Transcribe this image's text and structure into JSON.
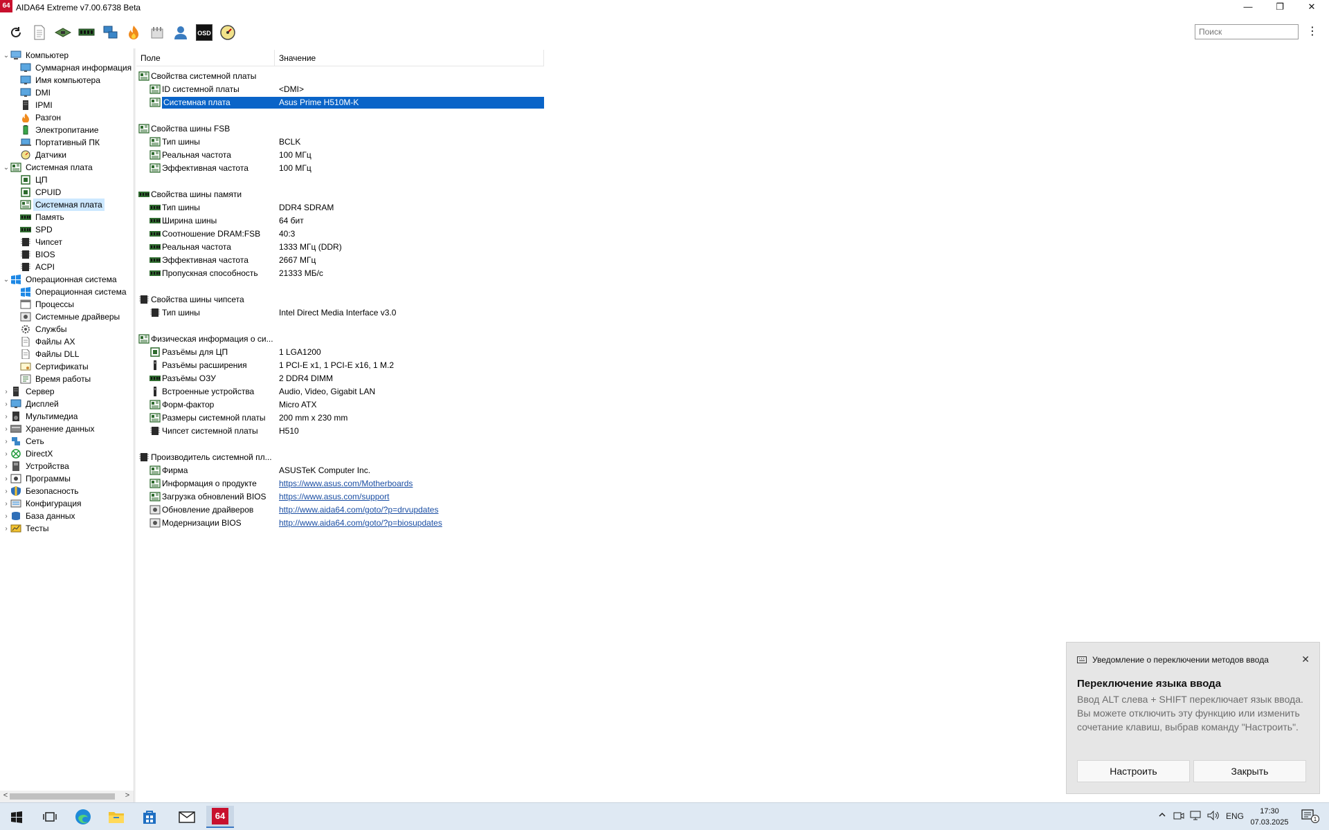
{
  "window": {
    "app_icon_text": "64",
    "title": "AIDA64 Extreme v7.00.6738 Beta",
    "controls": {
      "minimize": "—",
      "maximize": "❐",
      "close": "✕"
    }
  },
  "toolbar": {
    "icons": [
      "refresh-icon",
      "report-icon",
      "motherboard-icon",
      "memory-icon",
      "network-icon",
      "flame-icon",
      "tools-icon",
      "user-icon",
      "osd-icon",
      "gauge-icon"
    ],
    "osd_label": "OSD",
    "search_placeholder": "Поиск",
    "menu_glyph": "⋮"
  },
  "tree": {
    "nodes": [
      {
        "label": "Компьютер",
        "level": 0,
        "expanded": true,
        "icon": "computer-icon"
      },
      {
        "label": "Суммарная информация",
        "level": 1,
        "icon": "monitor-icon"
      },
      {
        "label": "Имя компьютера",
        "level": 1,
        "icon": "monitor-icon"
      },
      {
        "label": "DMI",
        "level": 1,
        "icon": "monitor-icon"
      },
      {
        "label": "IPMI",
        "level": 1,
        "icon": "server-icon"
      },
      {
        "label": "Разгон",
        "level": 1,
        "icon": "flame-icon"
      },
      {
        "label": "Электропитание",
        "level": 1,
        "icon": "battery-icon"
      },
      {
        "label": "Портативный ПК",
        "level": 1,
        "icon": "laptop-icon"
      },
      {
        "label": "Датчики",
        "level": 1,
        "icon": "gauge-icon"
      },
      {
        "label": "Системная плата",
        "level": 0,
        "expanded": true,
        "icon": "motherboard-icon"
      },
      {
        "label": "ЦП",
        "level": 1,
        "icon": "cpu-icon"
      },
      {
        "label": "CPUID",
        "level": 1,
        "icon": "cpu-icon"
      },
      {
        "label": "Системная плата",
        "level": 1,
        "icon": "motherboard-icon",
        "selected": true
      },
      {
        "label": "Память",
        "level": 1,
        "icon": "memory-icon"
      },
      {
        "label": "SPD",
        "level": 1,
        "icon": "memory-icon"
      },
      {
        "label": "Чипсет",
        "level": 1,
        "icon": "chip-icon"
      },
      {
        "label": "BIOS",
        "level": 1,
        "icon": "chip-icon"
      },
      {
        "label": "ACPI",
        "level": 1,
        "icon": "chip-icon"
      },
      {
        "label": "Операционная система",
        "level": 0,
        "expanded": true,
        "icon": "windows-icon"
      },
      {
        "label": "Операционная система",
        "level": 1,
        "icon": "windows-icon"
      },
      {
        "label": "Процессы",
        "level": 1,
        "icon": "window-icon"
      },
      {
        "label": "Системные драйверы",
        "level": 1,
        "icon": "driver-icon"
      },
      {
        "label": "Службы",
        "level": 1,
        "icon": "gear-icon"
      },
      {
        "label": "Файлы AX",
        "level": 1,
        "icon": "file-icon"
      },
      {
        "label": "Файлы DLL",
        "level": 1,
        "icon": "file-icon"
      },
      {
        "label": "Сертификаты",
        "level": 1,
        "icon": "certificate-icon"
      },
      {
        "label": "Время работы",
        "level": 1,
        "icon": "clock-icon"
      },
      {
        "label": "Сервер",
        "level": 0,
        "icon": "server-icon"
      },
      {
        "label": "Дисплей",
        "level": 0,
        "icon": "monitor-icon"
      },
      {
        "label": "Мультимедиа",
        "level": 0,
        "icon": "speaker-icon"
      },
      {
        "label": "Хранение данных",
        "level": 0,
        "icon": "disk-icon"
      },
      {
        "label": "Сеть",
        "level": 0,
        "icon": "network-icon"
      },
      {
        "label": "DirectX",
        "level": 0,
        "icon": "xbox-icon"
      },
      {
        "label": "Устройства",
        "level": 0,
        "icon": "device-icon"
      },
      {
        "label": "Программы",
        "level": 0,
        "icon": "program-icon"
      },
      {
        "label": "Безопасность",
        "level": 0,
        "icon": "shield-icon"
      },
      {
        "label": "Конфигурация",
        "level": 0,
        "icon": "config-icon"
      },
      {
        "label": "База данных",
        "level": 0,
        "icon": "database-icon"
      },
      {
        "label": "Тесты",
        "level": 0,
        "icon": "benchmark-icon"
      }
    ],
    "scroll_left": "<",
    "scroll_right": ">"
  },
  "list": {
    "columns": [
      "Поле",
      "Значение"
    ],
    "rows": [
      {
        "kind": "grp",
        "field": "Свойства системной платы",
        "value": "",
        "icon": "motherboard-icon"
      },
      {
        "kind": "item",
        "field": "ID системной платы",
        "value": "<DMI>",
        "icon": "motherboard-icon"
      },
      {
        "kind": "item",
        "field": "Системная плата",
        "value": "Asus Prime H510M-K",
        "icon": "motherboard-icon",
        "selected": true
      },
      {
        "kind": "blank"
      },
      {
        "kind": "grp",
        "field": "Свойства шины FSB",
        "value": "",
        "icon": "motherboard-icon"
      },
      {
        "kind": "item",
        "field": "Тип шины",
        "value": "BCLK",
        "icon": "motherboard-icon"
      },
      {
        "kind": "item",
        "field": "Реальная частота",
        "value": "100 МГц",
        "icon": "motherboard-icon"
      },
      {
        "kind": "item",
        "field": "Эффективная частота",
        "value": "100 МГц",
        "icon": "motherboard-icon"
      },
      {
        "kind": "blank"
      },
      {
        "kind": "grp",
        "field": "Свойства шины памяти",
        "value": "",
        "icon": "memory-icon"
      },
      {
        "kind": "item",
        "field": "Тип шины",
        "value": "DDR4 SDRAM",
        "icon": "memory-icon"
      },
      {
        "kind": "item",
        "field": "Ширина шины",
        "value": "64 бит",
        "icon": "memory-icon"
      },
      {
        "kind": "item",
        "field": "Соотношение DRAM:FSB",
        "value": "40:3",
        "icon": "memory-icon"
      },
      {
        "kind": "item",
        "field": "Реальная частота",
        "value": "1333 МГц (DDR)",
        "icon": "memory-icon"
      },
      {
        "kind": "item",
        "field": "Эффективная частота",
        "value": "2667 МГц",
        "icon": "memory-icon"
      },
      {
        "kind": "item",
        "field": "Пропускная способность",
        "value": "21333 МБ/с",
        "icon": "memory-icon"
      },
      {
        "kind": "blank"
      },
      {
        "kind": "grp",
        "field": "Свойства шины чипсета",
        "value": "",
        "icon": "chip-icon"
      },
      {
        "kind": "item",
        "field": "Тип шины",
        "value": "Intel Direct Media Interface v3.0",
        "icon": "chip-icon"
      },
      {
        "kind": "blank"
      },
      {
        "kind": "grp",
        "field": "Физическая информация о си...",
        "value": "",
        "icon": "motherboard-icon"
      },
      {
        "kind": "item",
        "field": "Разъёмы для ЦП",
        "value": "1 LGA1200",
        "icon": "cpu-icon"
      },
      {
        "kind": "item",
        "field": "Разъёмы расширения",
        "value": "1 PCI-E x1, 1 PCI-E x16, 1 M.2",
        "icon": "slot-icon"
      },
      {
        "kind": "item",
        "field": "Разъёмы ОЗУ",
        "value": "2 DDR4 DIMM",
        "icon": "memory-icon"
      },
      {
        "kind": "item",
        "field": "Встроенные устройства",
        "value": "Audio, Video, Gigabit LAN",
        "icon": "slot-icon"
      },
      {
        "kind": "item",
        "field": "Форм-фактор",
        "value": "Micro ATX",
        "icon": "motherboard-icon"
      },
      {
        "kind": "item",
        "field": "Размеры системной платы",
        "value": "200 mm x 230 mm",
        "icon": "motherboard-icon"
      },
      {
        "kind": "item",
        "field": "Чипсет системной платы",
        "value": "H510",
        "icon": "chip-icon"
      },
      {
        "kind": "blank"
      },
      {
        "kind": "grp",
        "field": "Производитель системной пл...",
        "value": "",
        "icon": "chip-icon"
      },
      {
        "kind": "item",
        "field": "Фирма",
        "value": "ASUSTeK Computer Inc.",
        "icon": "motherboard-icon"
      },
      {
        "kind": "item",
        "field": "Информация о продукте",
        "value": "https://www.asus.com/Motherboards",
        "icon": "motherboard-icon",
        "link": true
      },
      {
        "kind": "item",
        "field": "Загрузка обновлений BIOS",
        "value": "https://www.asus.com/support",
        "icon": "motherboard-icon",
        "link": true
      },
      {
        "kind": "item",
        "field": "Обновление драйверов",
        "value": "http://www.aida64.com/goto/?p=drvupdates",
        "icon": "driver-icon",
        "link": true
      },
      {
        "kind": "item",
        "field": "Модернизации BIOS",
        "value": "http://www.aida64.com/goto/?p=biosupdates",
        "icon": "driver-icon",
        "link": true
      }
    ]
  },
  "toast": {
    "header": "Уведомление о переключении методов ввода",
    "close_glyph": "✕",
    "title": "Переключение языка ввода",
    "body": "Ввод ALT слева + SHIFT переключает язык ввода. Вы можете отключить эту функцию или изменить сочетание клавиш, выбрав команду \"Настроить\".",
    "btn_configure": "Настроить",
    "btn_close": "Закрыть"
  },
  "taskbar": {
    "apps": [
      "windows-start-icon",
      "task-view-icon",
      "edge-icon",
      "file-explorer-icon",
      "store-icon",
      "mail-icon",
      "aida64-icon"
    ],
    "aida_label": "64",
    "lang": "ENG",
    "time": "17:30",
    "date": "07.03.2025",
    "notif_count": "1"
  },
  "colors": {
    "selection": "#0a64c8",
    "tree_selection": "#cde8ff",
    "link": "#1a4ea3",
    "brand": "#c8102e"
  }
}
